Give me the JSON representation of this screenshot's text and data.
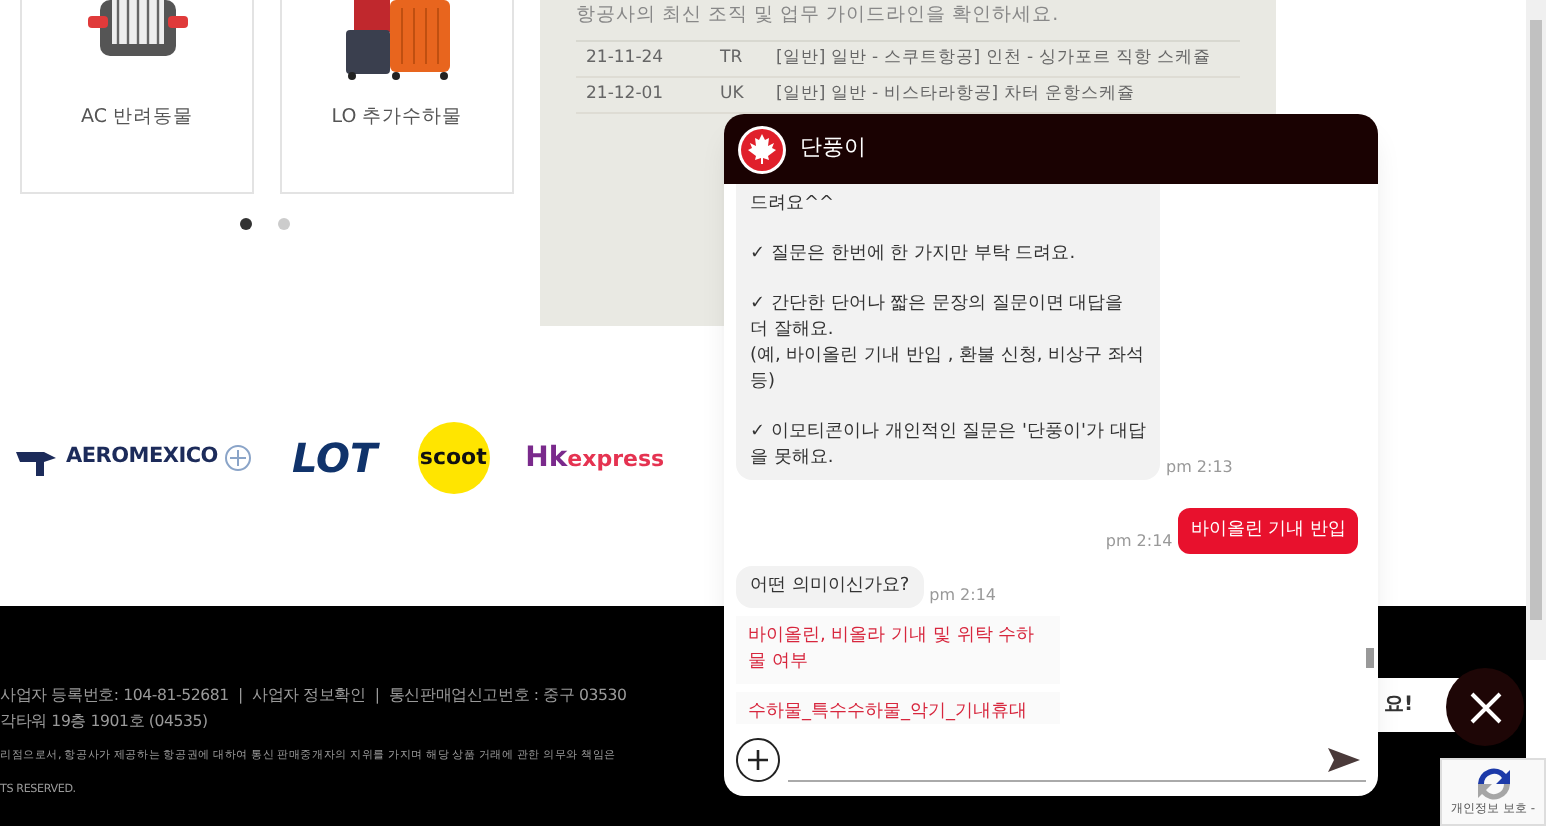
{
  "cards": [
    {
      "kind": "pet",
      "label": "AC 반려동물"
    },
    {
      "kind": "luggage",
      "label": "LO 추가수하물"
    }
  ],
  "carousel_dots": [
    {
      "selected": true
    },
    {
      "selected": false
    }
  ],
  "notice": {
    "subtitle": "항공사의 최신 조직 및 업무 가이드라인을 확인하세요.",
    "rows": [
      {
        "date": "21-11-24",
        "code": "TR",
        "title": "[일반] 일반 - 스쿠트항공] 인천 - 싱가포르 직항 스케쥴"
      },
      {
        "date": "21-12-01",
        "code": "UK",
        "title": "[일반] 일반 - 비스타라항공] 차터 운항스케쥴"
      }
    ]
  },
  "partner_logos": [
    {
      "kind": "aeromexico",
      "parts": [
        "AEROMEXICO"
      ]
    },
    {
      "kind": "lot",
      "parts": [
        "LOT"
      ]
    },
    {
      "kind": "scoot",
      "parts": [
        "scoot"
      ]
    },
    {
      "kind": "hk",
      "parts": [
        "Hk",
        "express"
      ]
    }
  ],
  "footer": {
    "lines": [
      "사업자 등록번호: 104-81-52681  |  사업자 정보확인  |  통신판매업신고번호 : 중구 03530",
      "각타워 19층 1901호 (04535)",
      "리점으로서, 항공사가 제공하는 항공권에 대하여 통신 판매중개자의 지위를 가지며 해당 상품 거래에 관한 의무와 책임은",
      "TS RESERVED."
    ]
  },
  "chat": {
    "title": "단풍이",
    "messages": [
      {
        "kind": "bot",
        "paragraphs": [
          [
            "드려요^^"
          ],
          [
            "✓ 질문은 한번에 한 가지만 부탁 드려요."
          ],
          [
            "✓ 간단한 단어나 짧은 문장의 질문이면 대답을 더 잘해요.",
            "(예, 바이올린 기내 반입 , 환불 신청, 비상구 좌석 등)"
          ],
          [
            "✓ 이모티콘이나 개인적인 질문은 '단풍이'가 대답을 못해요."
          ]
        ],
        "time": "pm 2:13"
      },
      {
        "kind": "user",
        "paragraphs": [
          [
            "바이올린 기내 반입"
          ]
        ],
        "time": "pm 2:14"
      },
      {
        "kind": "bot",
        "paragraphs": [
          [
            "어떤 의미이신가요?"
          ]
        ],
        "time": "pm 2:14"
      },
      {
        "kind": "option",
        "paragraphs": [
          [
            "바이올린, 비올라 기내 및 위탁 수하물 여부"
          ]
        ]
      },
      {
        "kind": "option",
        "paragraphs": [
          [
            "수하물_특수수하물_악기_기내휴대"
          ]
        ]
      }
    ]
  },
  "popup": {
    "text": "요!"
  },
  "recaptcha": {
    "text": "개인정보 보호 -"
  }
}
